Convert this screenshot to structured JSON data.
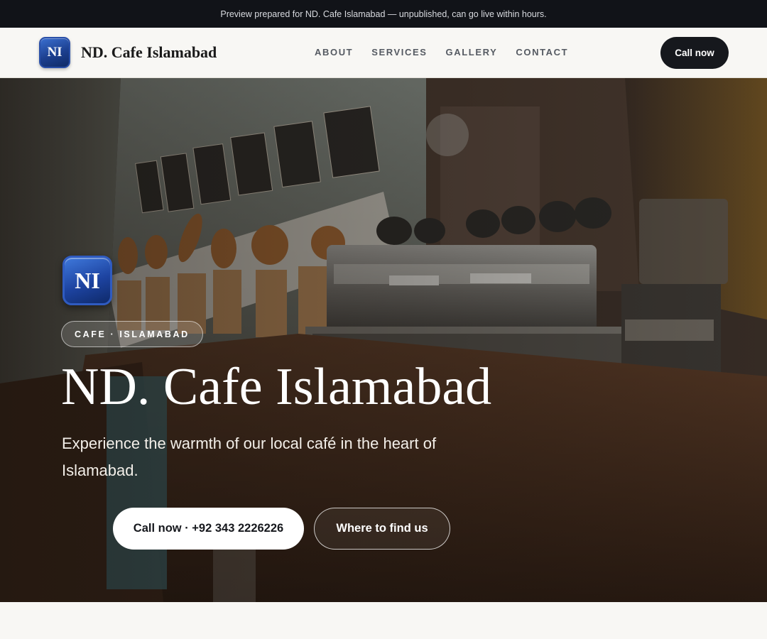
{
  "preview_bar": {
    "text": "Preview prepared for ND. Cafe Islamabad — unpublished, can go live within hours."
  },
  "nav": {
    "logo_initials": "NI",
    "brand_name": "ND. Cafe Islamabad",
    "links": [
      {
        "label": "ABOUT"
      },
      {
        "label": "SERVICES"
      },
      {
        "label": "GALLERY"
      },
      {
        "label": "CONTACT"
      }
    ],
    "cta_label": "Call now"
  },
  "hero": {
    "logo_initials": "NI",
    "tag": "CAFE · ISLAMABAD",
    "title": "ND. Cafe Islamabad",
    "subtitle": "Experience the warmth of our local café in the heart of Islamabad.",
    "primary_button": "Call now · +92 343 2226226",
    "secondary_button": "Where to find us",
    "image_label": "cafe-counter-espresso-machine-photo"
  },
  "colors": {
    "dark": "#16181d",
    "logo_blue": "#1d43a0",
    "page_bg": "#f8f7f4"
  }
}
